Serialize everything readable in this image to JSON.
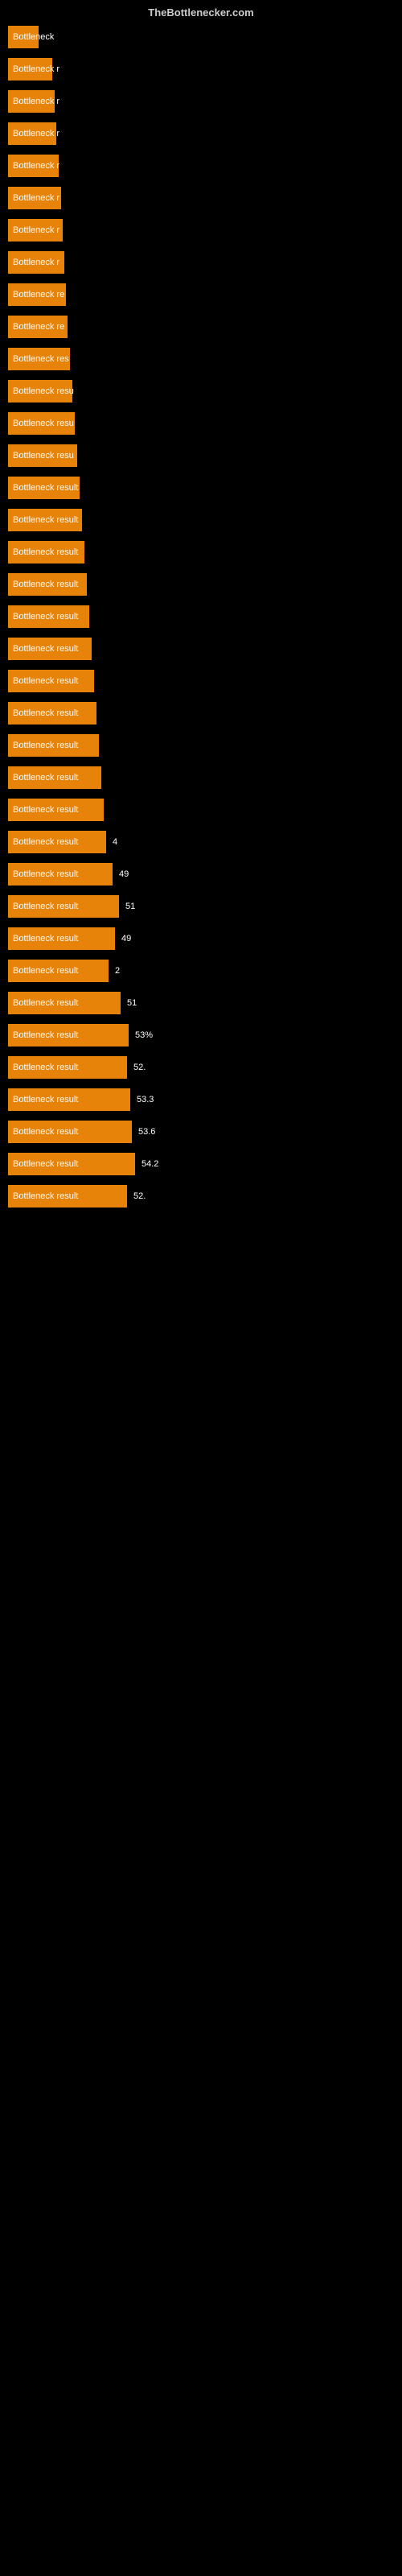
{
  "header": {
    "title": "TheBottlenecker.com"
  },
  "bars": [
    {
      "label": "Bottleneck",
      "value": null,
      "width": 38
    },
    {
      "label": "Bottleneck r",
      "value": null,
      "width": 55
    },
    {
      "label": "Bottleneck r",
      "value": null,
      "width": 58
    },
    {
      "label": "Bottleneck r",
      "value": null,
      "width": 60
    },
    {
      "label": "Bottleneck r",
      "value": null,
      "width": 63
    },
    {
      "label": "Bottleneck r",
      "value": null,
      "width": 66
    },
    {
      "label": "Bottleneck r",
      "value": null,
      "width": 68
    },
    {
      "label": "Bottleneck r",
      "value": null,
      "width": 70
    },
    {
      "label": "Bottleneck re",
      "value": null,
      "width": 72
    },
    {
      "label": "Bottleneck re",
      "value": null,
      "width": 74
    },
    {
      "label": "Bottleneck res",
      "value": null,
      "width": 77
    },
    {
      "label": "Bottleneck resu",
      "value": null,
      "width": 80
    },
    {
      "label": "Bottleneck resu",
      "value": null,
      "width": 83
    },
    {
      "label": "Bottleneck resu",
      "value": null,
      "width": 86
    },
    {
      "label": "Bottleneck result",
      "value": null,
      "width": 89
    },
    {
      "label": "Bottleneck result",
      "value": null,
      "width": 92
    },
    {
      "label": "Bottleneck result",
      "value": null,
      "width": 95
    },
    {
      "label": "Bottleneck result",
      "value": null,
      "width": 98
    },
    {
      "label": "Bottleneck result",
      "value": null,
      "width": 101
    },
    {
      "label": "Bottleneck result",
      "value": null,
      "width": 104
    },
    {
      "label": "Bottleneck result",
      "value": null,
      "width": 107
    },
    {
      "label": "Bottleneck result",
      "value": null,
      "width": 110
    },
    {
      "label": "Bottleneck result",
      "value": null,
      "width": 113
    },
    {
      "label": "Bottleneck result",
      "value": null,
      "width": 116
    },
    {
      "label": "Bottleneck result",
      "value": null,
      "width": 119
    },
    {
      "label": "Bottleneck result",
      "value": "4",
      "width": 122
    },
    {
      "label": "Bottleneck result",
      "value": "49",
      "width": 130
    },
    {
      "label": "Bottleneck result",
      "value": "51",
      "width": 138
    },
    {
      "label": "Bottleneck result",
      "value": "49",
      "width": 133
    },
    {
      "label": "Bottleneck result",
      "value": "2",
      "width": 125
    },
    {
      "label": "Bottleneck result",
      "value": "51",
      "width": 140
    },
    {
      "label": "Bottleneck result",
      "value": "53%",
      "width": 150
    },
    {
      "label": "Bottleneck result",
      "value": "52.",
      "width": 148
    },
    {
      "label": "Bottleneck result",
      "value": "53.3",
      "width": 152
    },
    {
      "label": "Bottleneck result",
      "value": "53.6",
      "width": 154
    },
    {
      "label": "Bottleneck result",
      "value": "54.2",
      "width": 158
    },
    {
      "label": "Bottleneck result",
      "value": "52.",
      "width": 148
    }
  ]
}
